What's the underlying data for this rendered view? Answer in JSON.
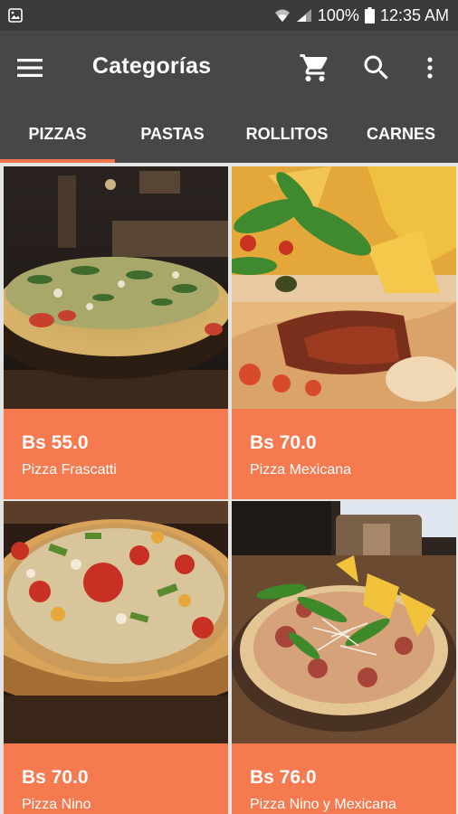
{
  "status_bar": {
    "battery": "100%",
    "time": "12:35 AM",
    "icons": [
      "image-notification-icon",
      "wifi-icon",
      "signal-icon",
      "battery-icon"
    ]
  },
  "app_bar": {
    "title": "Categorías",
    "icons": [
      "menu-icon",
      "cart-icon",
      "search-icon",
      "more-vert-icon"
    ]
  },
  "tabs": [
    {
      "label": "PIZZAS",
      "selected": true
    },
    {
      "label": "PASTAS",
      "selected": false
    },
    {
      "label": "ROLLITOS",
      "selected": false
    },
    {
      "label": "CARNES",
      "selected": false
    }
  ],
  "products": [
    {
      "price": "Bs 55.0",
      "name": "Pizza Frascatti"
    },
    {
      "price": "Bs 70.0",
      "name": "Pizza Mexicana"
    },
    {
      "price": "Bs 70.0",
      "name": "Pizza Nino"
    },
    {
      "price": "Bs 76.0",
      "name": "Pizza Nino y Mexicana"
    }
  ],
  "colors": {
    "status_bar": "#3a3a3a",
    "app_bar": "#474747",
    "accent": "#f4764f",
    "card_info": "#f57a50",
    "grid_background": "#e4e4e4"
  }
}
